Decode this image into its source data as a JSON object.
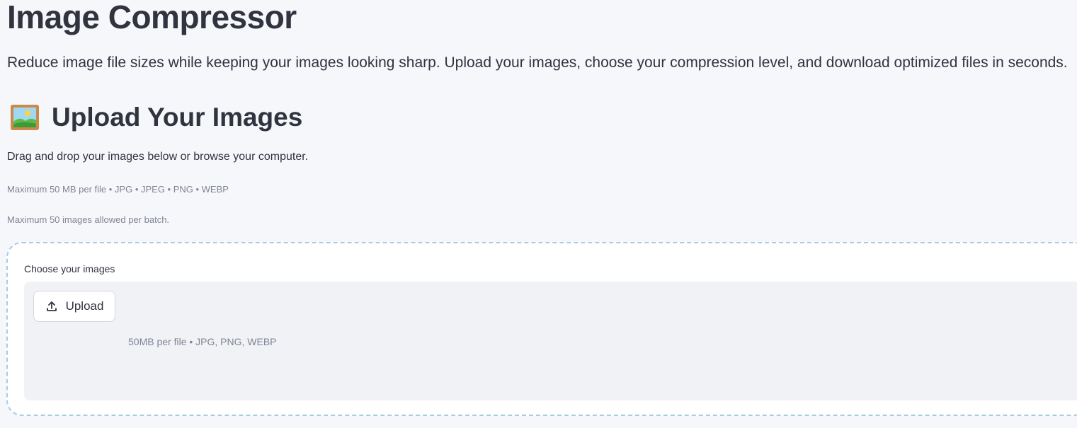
{
  "page": {
    "title": "Image Compressor",
    "intro": "Reduce image file sizes while keeping your images looking sharp. Upload your images, choose your compression level, and download optimized files in seconds."
  },
  "upload_section": {
    "icon": "framed-picture-icon",
    "heading": "Upload Your Images",
    "instructions": "Drag and drop your images below or browse your computer.",
    "caption_limits": "Maximum 50 MB per file • JPG • JPEG • PNG • WEBP",
    "caption_batch": "Maximum 50 images allowed per batch."
  },
  "uploader": {
    "label": "Choose your images",
    "button_icon": "upload-icon",
    "button_label": "Upload",
    "hint": "50MB per file • JPG, PNG, WEBP"
  },
  "colors": {
    "background": "#f6f7fb",
    "text": "#31333f",
    "muted_text": "#808495",
    "dropzone_background": "#f0f2f6",
    "dashed_border": "#a7cde6"
  }
}
